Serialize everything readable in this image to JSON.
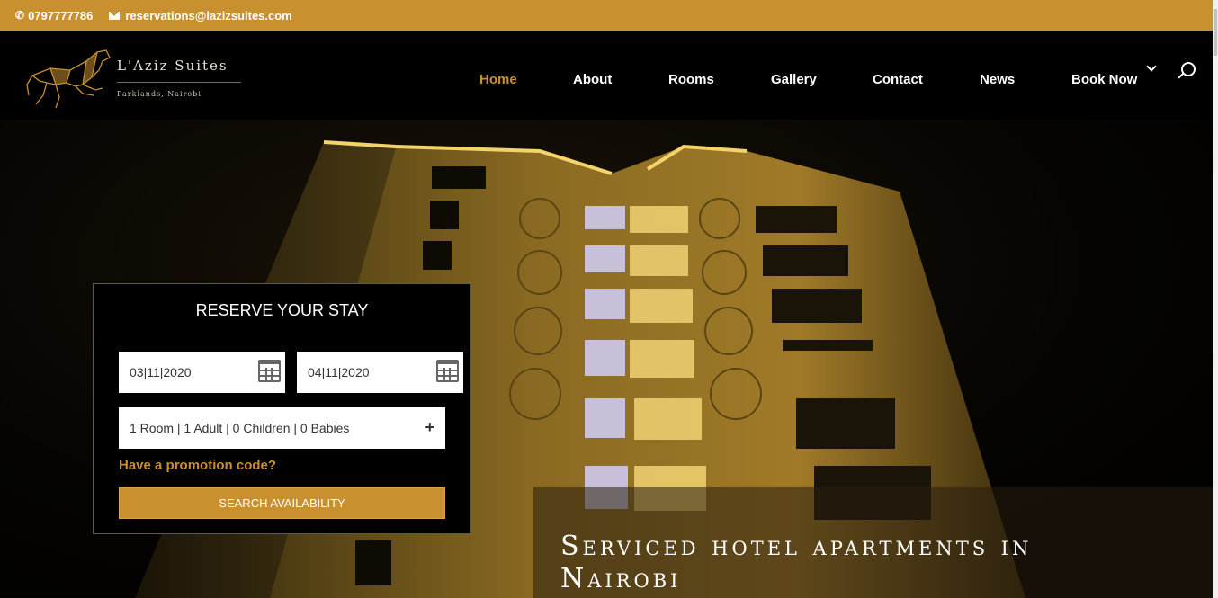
{
  "topbar": {
    "phone": "0797777786",
    "email": "reservations@lazizsuites.com"
  },
  "brand": {
    "name": "L'Aziz Suites",
    "tagline": "Parklands, Nairobi"
  },
  "nav": {
    "items": [
      {
        "label": "Home",
        "active": true
      },
      {
        "label": "About"
      },
      {
        "label": "Rooms"
      },
      {
        "label": "Gallery"
      },
      {
        "label": "Contact"
      },
      {
        "label": "News"
      },
      {
        "label": "Book Now"
      }
    ]
  },
  "reserve": {
    "title": "RESERVE YOUR STAY",
    "checkin": "03|11|2020",
    "checkout": "04|11|2020",
    "guests": "1 Room | 1 Adult | 0 Children | 0 Babies",
    "promo": "Have a promotion code?",
    "button": "SEARCH AVAILABILITY"
  },
  "hero": {
    "headline_line1": "Serviced hotel apartments in",
    "headline_line2": "Nairobi"
  },
  "colors": {
    "accent": "#c9902f"
  },
  "icons": [
    "phone-icon",
    "email-icon",
    "chevron-down-icon",
    "search-icon",
    "calendar-icon",
    "plus-icon"
  ]
}
